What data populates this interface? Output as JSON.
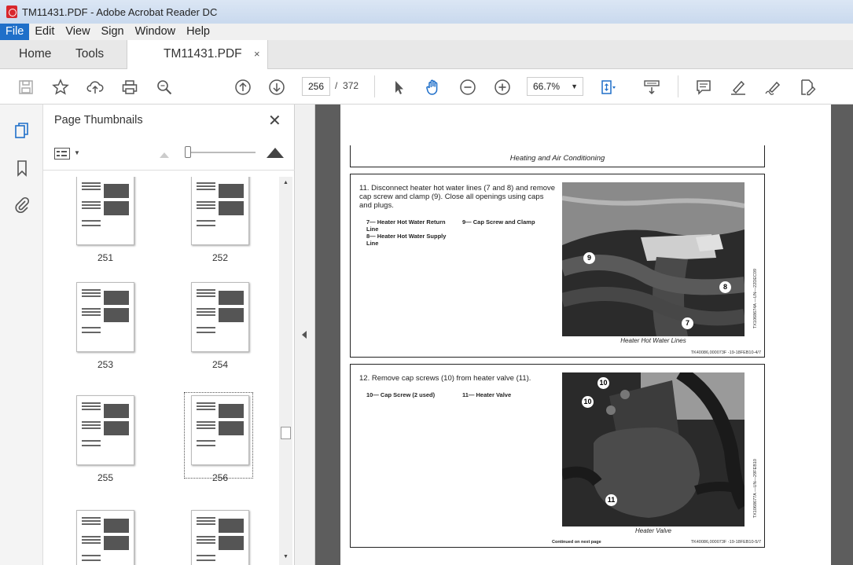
{
  "window": {
    "title": "TM11431.PDF - Adobe Acrobat Reader DC"
  },
  "menu": [
    "File",
    "Edit",
    "View",
    "Sign",
    "Window",
    "Help"
  ],
  "tabs": {
    "home": "Home",
    "tools": "Tools",
    "document": "TM11431.PDF",
    "close": "×"
  },
  "toolbar": {
    "current_page": "256",
    "page_separator": "/",
    "total_pages": "372",
    "zoom": "66.7%"
  },
  "panel": {
    "title": "Page Thumbnails",
    "thumbnails": [
      {
        "label": "251"
      },
      {
        "label": "252"
      },
      {
        "label": "253"
      },
      {
        "label": "254"
      },
      {
        "label": "255"
      },
      {
        "label": "256"
      },
      {
        "label": ""
      },
      {
        "label": ""
      }
    ],
    "selected_page": "256"
  },
  "document": {
    "header": "Heating and Air Conditioning",
    "step1": {
      "text": "11. Disconnect heater hot water lines (7 and 8) and remove cap screw and clamp (9). Close all openings using caps and plugs.",
      "legend_left": [
        "7— Heater Hot Water Return Line",
        "8— Heater Hot Water Supply Line"
      ],
      "legend_right": [
        "9— Cap Screw and Clamp"
      ],
      "callouts": [
        "9",
        "8",
        "7"
      ],
      "caption": "Heater Hot Water Lines",
      "side_code": "TX1068674A —UN—22DEC09",
      "ref_code": "TK40086,000073F -19-18FEB10-4/7"
    },
    "step2": {
      "text": "12. Remove cap screws (10) from heater valve (11).",
      "legend_left": [
        "10— Cap Screw (2 used)"
      ],
      "legend_right": [
        "11— Heater Valve"
      ],
      "callouts": [
        "10",
        "10",
        "11"
      ],
      "caption": "Heater Valve",
      "side_code": "TX1068677A —UN—29FEB10",
      "ref_code": "TK40086,000073F -19-18FEB10-5/7",
      "continued": "Continued on next page"
    }
  }
}
